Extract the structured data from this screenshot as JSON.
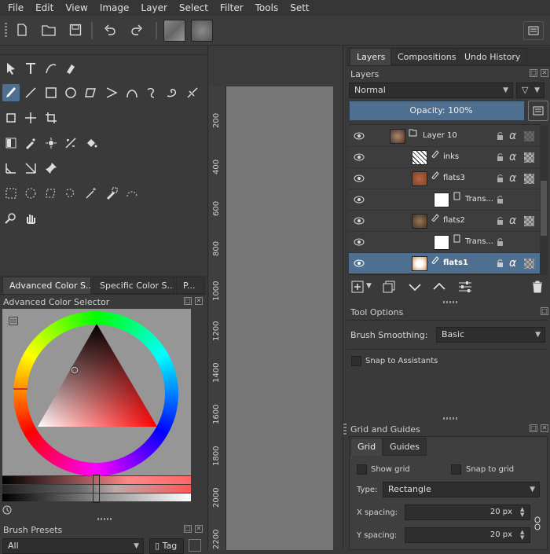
{
  "menubar": {
    "items": [
      "File",
      "Edit",
      "View",
      "Image",
      "Layer",
      "Select",
      "Filter",
      "Tools",
      "Sett"
    ]
  },
  "docker_tabs_left": {
    "items": [
      "Advanced Color S...",
      "Specific Color S...",
      "P..."
    ]
  },
  "color_selector": {
    "title": "Advanced Color Selector"
  },
  "brush_presets": {
    "title": "Brush Presets",
    "filter_value": "All",
    "tag_label": "Tag"
  },
  "ruler": {
    "ticks": [
      "200",
      "400",
      "600",
      "800",
      "1000",
      "1200",
      "1400",
      "1600",
      "1800",
      "2000",
      "2200"
    ]
  },
  "right_tabs": {
    "items": [
      "Layers",
      "Compositions",
      "Undo History"
    ],
    "active": "Layers"
  },
  "layers": {
    "title": "Layers",
    "blend_mode": "Normal",
    "opacity_label": "Opacity:",
    "opacity_value": "100%",
    "rows": [
      {
        "name": "Layer 10"
      },
      {
        "name": "inks"
      },
      {
        "name": "flats3"
      },
      {
        "name": "Trans..."
      },
      {
        "name": "flats2"
      },
      {
        "name": "Trans..."
      },
      {
        "name": "flats1"
      }
    ],
    "selected": "flats1"
  },
  "tool_options": {
    "title": "Tool Options",
    "smoothing_label": "Brush Smoothing:",
    "smoothing_value": "Basic",
    "snap_label": "Snap to Assistants"
  },
  "grid_guides": {
    "title": "Grid and Guides",
    "tabs": [
      "Grid",
      "Guides"
    ],
    "show_grid": "Show grid",
    "snap_grid": "Snap to grid",
    "type_label": "Type:",
    "type_value": "Rectangle",
    "x_label": "X spacing:",
    "x_value": "20 px",
    "y_label": "Y spacing:",
    "y_value": "20 px"
  },
  "colors": {
    "accent": "#4f6f91",
    "panel": "#3a3a3a",
    "canvas": "#777777"
  }
}
